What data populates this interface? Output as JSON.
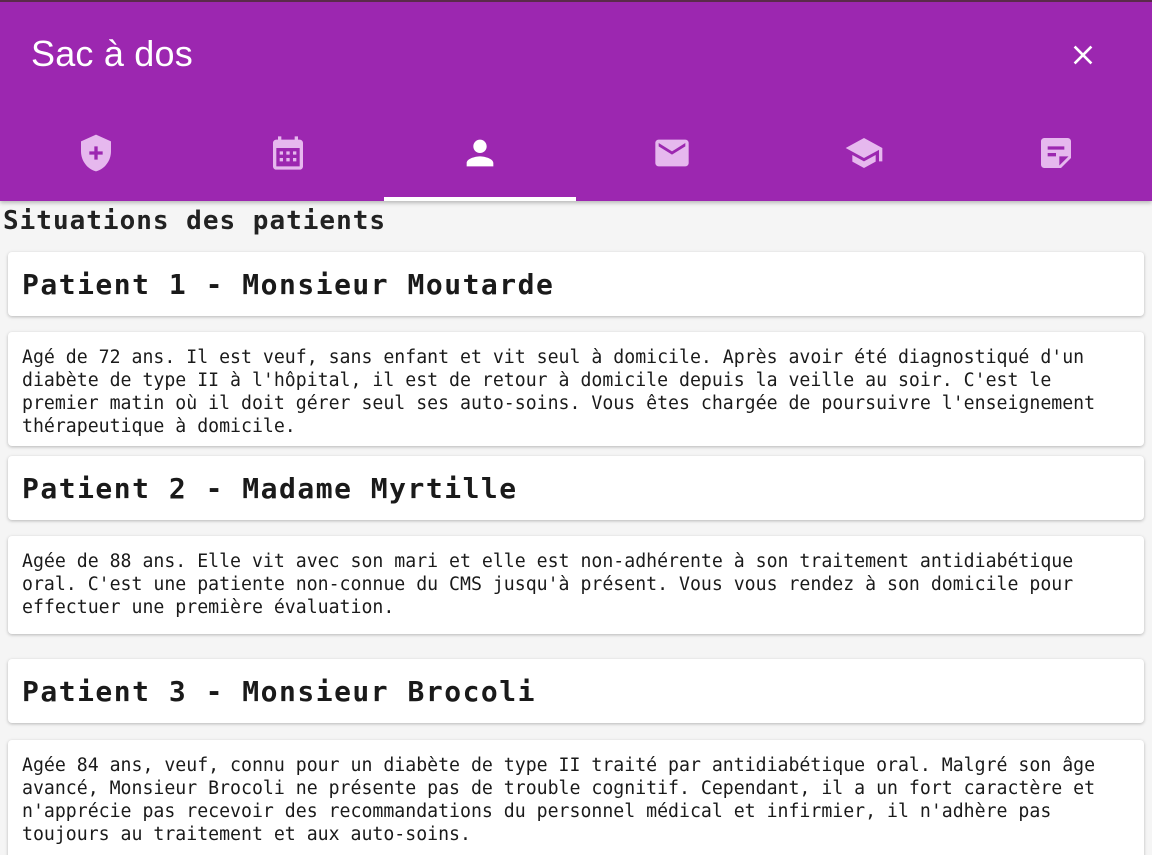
{
  "app": {
    "title": "Sac à dos"
  },
  "tabs": [
    {
      "icon": "shield-plus-icon",
      "active": false
    },
    {
      "icon": "calendar-icon",
      "active": false
    },
    {
      "icon": "person-icon",
      "active": true
    },
    {
      "icon": "mail-icon",
      "active": false
    },
    {
      "icon": "school-icon",
      "active": false
    },
    {
      "icon": "note-icon",
      "active": false
    }
  ],
  "colors": {
    "appbar": "#9c27b0",
    "tab_inactive_icon": "#e6b8ee",
    "tab_active_icon": "#ffffff"
  },
  "section": {
    "heading": "Situations des patients"
  },
  "patients": [
    {
      "title": "Patient 1 - Monsieur Moutarde",
      "description": "Agé de 72 ans. Il est veuf, sans enfant et vit seul à domicile. Après avoir été diagnostiqué d'un diabète de type II à l'hôpital, il est de retour à domicile depuis la veille au soir. C'est le premier matin où il doit gérer seul ses auto-soins. Vous êtes chargée de poursuivre l'enseignement thérapeutique à domicile."
    },
    {
      "title": "Patient 2 - Madame Myrtille",
      "description": "Agée de 88 ans. Elle vit avec son mari et elle est non-adhérente à son traitement antidiabétique oral.  C'est une patiente non-connue du CMS jusqu'à présent. Vous vous rendez à son domicile pour effectuer une première évaluation."
    },
    {
      "title": "Patient 3 - Monsieur Brocoli",
      "description": "Agée 84 ans, veuf, connu pour un diabète de type II traité par antidiabétique oral. Malgré son âge avancé, Monsieur Brocoli ne présente pas de trouble cognitif. Cependant, il a un fort caractère et n'apprécie pas recevoir des recommandations du personnel médical et infirmier, il n'adhère pas toujours au traitement et aux auto-soins."
    }
  ]
}
